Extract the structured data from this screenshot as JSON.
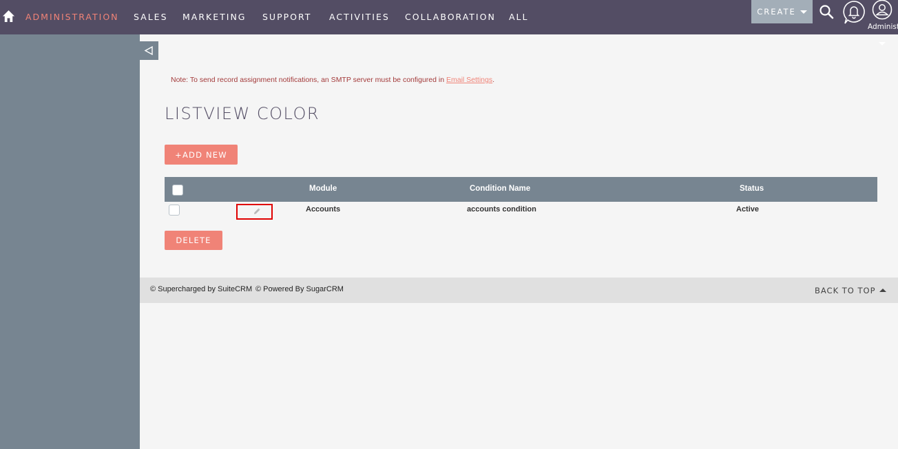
{
  "nav": {
    "items": [
      {
        "label": "ADMINISTRATION",
        "active": true
      },
      {
        "label": "SALES"
      },
      {
        "label": "MARKETING"
      },
      {
        "label": "SUPPORT"
      },
      {
        "label": "ACTIVITIES"
      },
      {
        "label": "COLLABORATION"
      },
      {
        "label": "ALL"
      }
    ],
    "create_label": "CREATE",
    "user_label": "Administrator",
    "icons": [
      "home-icon",
      "search-icon",
      "bell-icon",
      "user-icon",
      "chevron-down-icon"
    ]
  },
  "sidebar": {
    "collapse_icon": "triangle-left-icon"
  },
  "content": {
    "note_text": "Note: To send record assignment notifications, an SMTP server must be configured in ",
    "note_link": "Email Settings",
    "note_end": ".",
    "title": "LISTVIEW COLOR",
    "add_button": "+ADD NEW",
    "delete_button": "DELETE",
    "table": {
      "headers": [
        "Module",
        "Condition Name",
        "Status"
      ],
      "rows": [
        {
          "module": "Accounts",
          "condition_name": "accounts condition",
          "status": "Active"
        }
      ]
    }
  },
  "footer": {
    "supercharged": "© Supercharged by SuiteCRM",
    "powered": "© Powered By SugarCRM",
    "back_to_top": "BACK TO TOP"
  },
  "colors": {
    "nav_bg": "#534d64",
    "sidebar_bg": "#778591",
    "accent": "#f08377",
    "highlight": "#e00000"
  }
}
